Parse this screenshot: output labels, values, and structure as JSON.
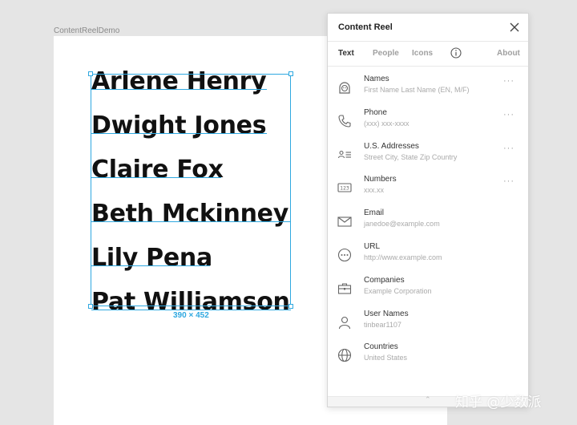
{
  "canvas": {
    "frame_label": "ContentReelDemo",
    "names": [
      "Arlene Henry",
      "Dwight Jones",
      "Claire Fox",
      "Beth Mckinney",
      "Lily Pena",
      "Pat Williamson"
    ],
    "selection_size": "390 × 452"
  },
  "panel": {
    "title": "Content Reel",
    "tabs": [
      "Text",
      "People",
      "Icons",
      "About"
    ],
    "active_tab": "Text",
    "items": [
      {
        "title": "Names",
        "subtitle": "First Name Last Name (EN, M/F)",
        "icon": "face-icon",
        "more": "···"
      },
      {
        "title": "Phone",
        "subtitle": "(xxx) xxx-xxxx",
        "icon": "phone-icon",
        "more": "···"
      },
      {
        "title": "U.S. Addresses",
        "subtitle": "Street City, State Zip Country",
        "icon": "address-card-icon",
        "more": "···"
      },
      {
        "title": "Numbers",
        "subtitle": "xxx.xx",
        "icon": "number-123-icon",
        "more": "···"
      },
      {
        "title": "Email",
        "subtitle": "janedoe@example.com",
        "icon": "envelope-icon",
        "more": ""
      },
      {
        "title": "URL",
        "subtitle": "http://www.example.com",
        "icon": "link-icon",
        "more": ""
      },
      {
        "title": "Companies",
        "subtitle": "Example Corporation",
        "icon": "briefcase-icon",
        "more": ""
      },
      {
        "title": "User Names",
        "subtitle": "tinbear1107",
        "icon": "user-icon",
        "more": ""
      },
      {
        "title": "Countries",
        "subtitle": "United States",
        "icon": "globe-icon",
        "more": ""
      }
    ],
    "footer_caret": "⌃"
  },
  "watermark": "知乎 @少数派",
  "colors": {
    "selection": "#2fa8e0",
    "canvas_bg": "#e5e5e5"
  }
}
